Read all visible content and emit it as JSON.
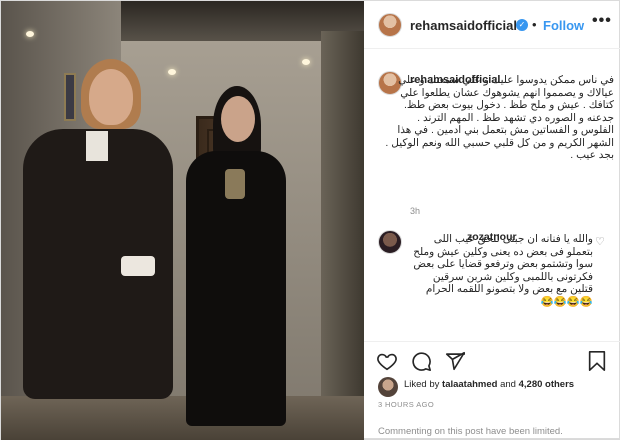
{
  "post": {
    "username": "rehamsaidofficial",
    "verified_mark": "✓",
    "dot": "•",
    "follow_label": "Follow",
    "more_label": "•••"
  },
  "caption": {
    "username": "rehamsaidofficial",
    "text": "في ناس ممكن يدوسوا عليك و علي سمعتك و علي عيالاك و يصمموا انهم يشوهوك عشان يطلعوا علي كتافك . عيش و ملح طظ . دخول بيوت بعض طظ. جدعنه و الصوره دي تشهد طظ . المهم الترند . الفلوس و الفساتين مش بتعمل بني ادمين . في هذا الشهر الكريم و من كل قلبي حسبي الله ونعم الوكيل . بجد عيب .",
    "time": "3h"
  },
  "comment": {
    "username": "zozatnour",
    "text": "والله يا فنانه ان جبتى للحق عيب اللى بتعملو فى بعض ده يعنى وكلين عيش وملح سوا وتشتمو بعض وترفعو قضايا على بعض فكرتونى باللمبى وكلين شربن سرقين قتلين مع بعض ولا بتصونو اللقمه الحرام 😂😂😂😂"
  },
  "likes": {
    "liked_by_prefix": "Liked by",
    "liked_by_user": "talaatahmed",
    "and": "and",
    "others": "4,280 others"
  },
  "post_time": "3 HOURS AGO",
  "limited_notice": "Commenting on this post have been limited.",
  "icons": {
    "like": "heart-icon",
    "comment": "comment-icon",
    "share": "share-icon",
    "save": "bookmark-icon"
  },
  "colors": {
    "accent": "#3897f0",
    "text": "#262626",
    "muted": "#8e8e8e"
  }
}
